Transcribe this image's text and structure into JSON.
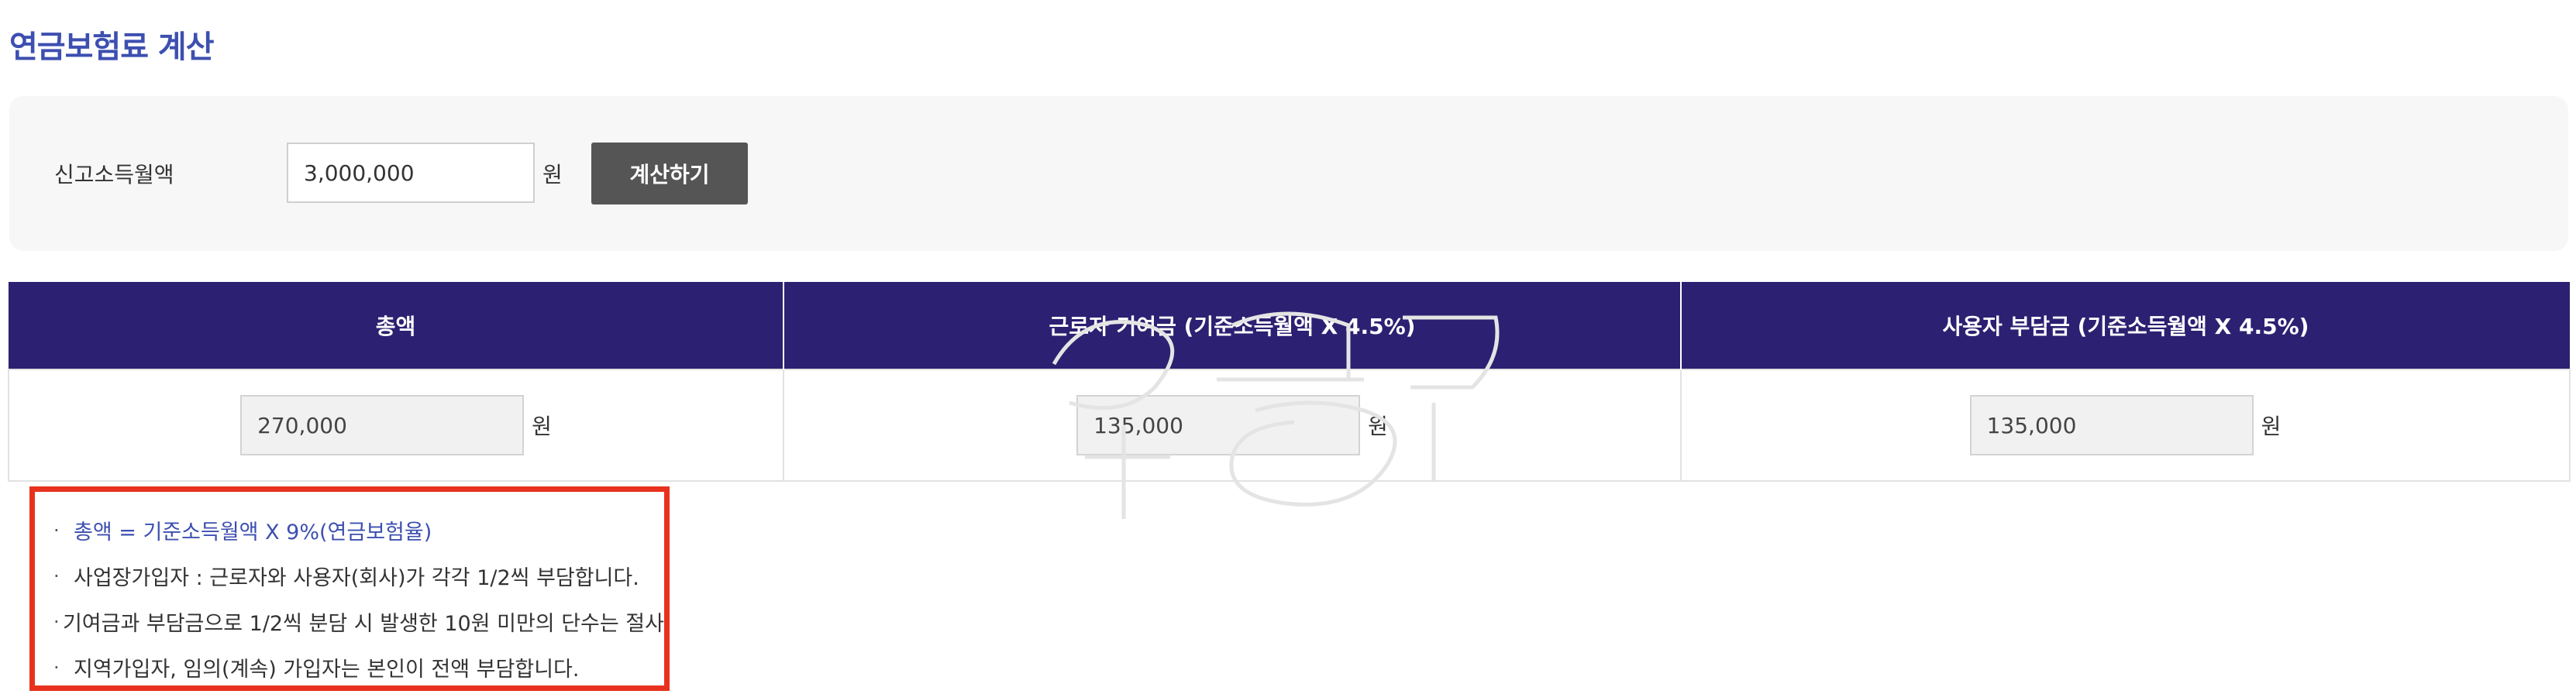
{
  "page": {
    "title": "연금보험료 계산"
  },
  "input_panel": {
    "income_label": "신고소득월액",
    "income_value": "3,000,000",
    "unit": "원",
    "calculate_button": "계산하기"
  },
  "result_table": {
    "headers": [
      "총액",
      "근로자 기여금 (기준소득월액 X 4.5%)",
      "사용자 부담금 (기준소득월액 X 4.5%)"
    ],
    "values": [
      "270,000",
      "135,000",
      "135,000"
    ],
    "unit": "원"
  },
  "notes": {
    "bullet": "·",
    "items": [
      "총액 = 기준소득월액 X 9%(연금보험율)",
      "사업장가입자 : 근로자와 사용자(회사)가 각각 1/2씩 부담합니다.",
      "기여금과 부담금으로 1/2씩 분담 시 발생한 10원 미만의 단수는 절사",
      "지역가입자, 임의(계속) 가입자는 본인이 전액 부담합니다."
    ]
  },
  "colors": {
    "title_accent": "#3d4fb0",
    "table_header_bg": "#2c2072",
    "button_bg": "#555555",
    "highlight_border": "#e8321e"
  }
}
